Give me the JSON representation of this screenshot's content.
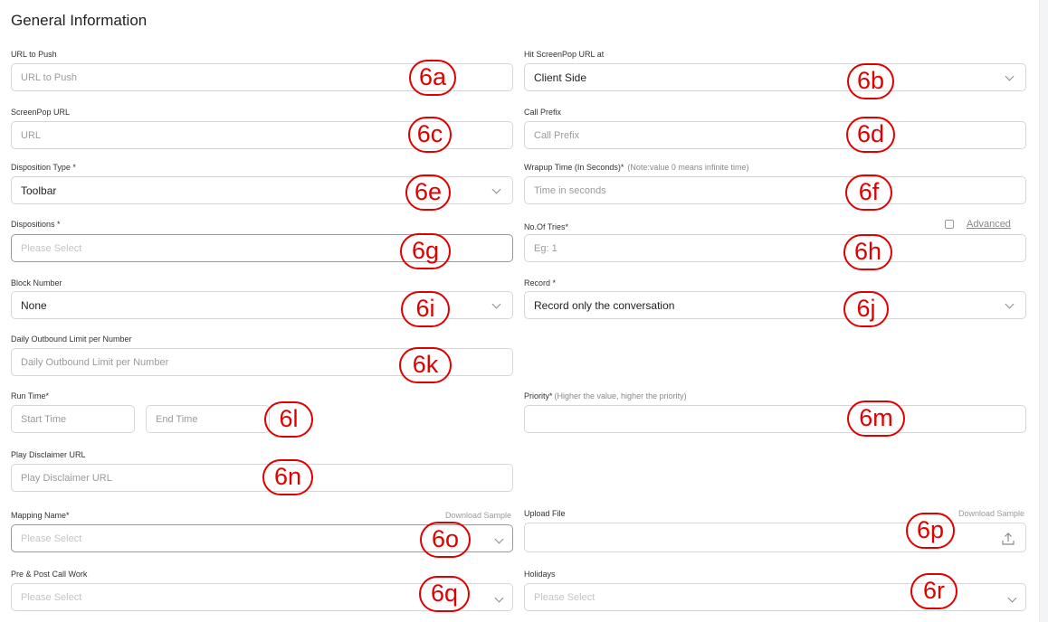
{
  "section_title": "General Information",
  "fields": {
    "url_to_push": {
      "label": "URL to Push",
      "placeholder": "URL to Push"
    },
    "hit_screenpop": {
      "label": "Hit ScreenPop URL at",
      "value": "Client Side"
    },
    "screenpop_url": {
      "label": "ScreenPop URL",
      "placeholder": "URL"
    },
    "call_prefix": {
      "label": "Call Prefix",
      "placeholder": "Call Prefix"
    },
    "disposition_type": {
      "label": "Disposition Type *",
      "value": "Toolbar"
    },
    "wrapup_time": {
      "label": "Wrapup Time (In Seconds)*",
      "note": "(Note:value 0 means infinite time)",
      "placeholder": "Time in seconds"
    },
    "dispositions": {
      "label": "Dispositions *",
      "placeholder": "Please Select"
    },
    "no_of_tries": {
      "label": "No.Of Tries*",
      "placeholder": "Eg: 1"
    },
    "advanced": {
      "label": "Advanced"
    },
    "block_number": {
      "label": "Block Number",
      "value": "None"
    },
    "record": {
      "label": "Record *",
      "value": "Record only the conversation"
    },
    "daily_outbound": {
      "label": "Daily Outbound Limit per Number",
      "placeholder": "Daily Outbound Limit per Number"
    },
    "run_time": {
      "label": "Run Time*",
      "start_placeholder": "Start Time",
      "end_placeholder": "End Time"
    },
    "priority": {
      "label": "Priority*",
      "note": "(Higher the value, higher the priority)"
    },
    "play_disclaimer": {
      "label": "Play Disclaimer URL",
      "placeholder": "Play Disclaimer URL"
    },
    "mapping_name": {
      "label": "Mapping Name*",
      "download": "Download Sample",
      "placeholder": "Please Select"
    },
    "upload_file": {
      "label": "Upload File",
      "download": "Download Sample"
    },
    "pre_post_call": {
      "label": "Pre & Post Call Work",
      "placeholder": "Please Select"
    },
    "holidays": {
      "label": "Holidays",
      "placeholder": "Please Select"
    }
  },
  "markers": {
    "m6a": "6a",
    "m6b": "6b",
    "m6c": "6c",
    "m6d": "6d",
    "m6e": "6e",
    "m6f": "6f",
    "m6g": "6g",
    "m6h": "6h",
    "m6i": "6i",
    "m6j": "6j",
    "m6k": "6k",
    "m6l": "6l",
    "m6m": "6m",
    "m6n": "6n",
    "m6o": "6o",
    "m6p": "6p",
    "m6q": "6q",
    "m6r": "6r"
  },
  "icons": {
    "chevron": "chevron-down-icon",
    "upload": "upload-icon",
    "checkbox": "checkbox"
  },
  "colors": {
    "marker_red": "#e00000",
    "border": "#d6d6d6",
    "placeholder": "#9b9b9b"
  }
}
